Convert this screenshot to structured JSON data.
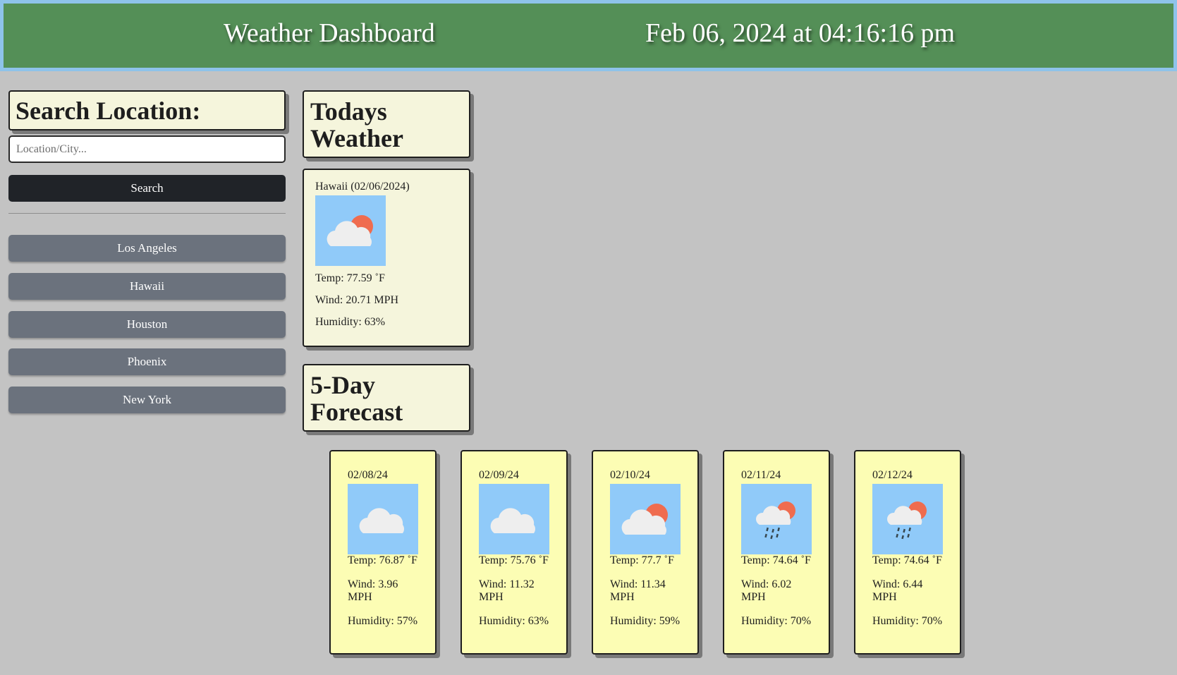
{
  "header": {
    "title": "Weather Dashboard",
    "datetime": "Feb 06, 2024 at 04:16:16 pm"
  },
  "sidebar": {
    "heading": "Search Location:",
    "search_placeholder": "Location/City...",
    "search_value": "",
    "search_button": "Search",
    "history": [
      "Los Angeles",
      "Hawaii",
      "Houston",
      "Phoenix",
      "New York"
    ]
  },
  "today": {
    "heading": "Todays Weather",
    "location": "Hawaii (02/06/2024)",
    "icon": "partly-cloudy-icon",
    "temp": "Temp: 77.59 ˚F",
    "wind": "Wind: 20.71 MPH",
    "humidity": "Humidity: 63%"
  },
  "forecast": {
    "heading": "5-Day Forecast",
    "days": [
      {
        "date": "02/08/24",
        "icon": "cloud-icon",
        "temp": "Temp: 76.87 ˚F",
        "wind": "Wind: 3.96 MPH",
        "humidity": "Humidity: 57%"
      },
      {
        "date": "02/09/24",
        "icon": "cloud-icon",
        "temp": "Temp: 75.76 ˚F",
        "wind": "Wind: 11.32 MPH",
        "humidity": "Humidity: 63%"
      },
      {
        "date": "02/10/24",
        "icon": "partly-cloudy-icon",
        "temp": "Temp: 77.7 ˚F",
        "wind": "Wind: 11.34 MPH",
        "humidity": "Humidity: 59%"
      },
      {
        "date": "02/11/24",
        "icon": "rain-sun-icon",
        "temp": "Temp: 74.64 ˚F",
        "wind": "Wind: 6.02 MPH",
        "humidity": "Humidity: 70%"
      },
      {
        "date": "02/12/24",
        "icon": "rain-sun-icon",
        "temp": "Temp: 74.64 ˚F",
        "wind": "Wind: 6.44 MPH",
        "humidity": "Humidity: 70%"
      }
    ]
  },
  "colors": {
    "header_bg": "#548f57",
    "header_border": "#8ec3ea",
    "page_bg": "#c3c3c3",
    "panel_bg": "#f5f5dc",
    "forecast_card_bg": "#fcfdb4",
    "icon_bg": "#90caf9",
    "search_button": "#202328",
    "city_button": "#6b727d"
  }
}
